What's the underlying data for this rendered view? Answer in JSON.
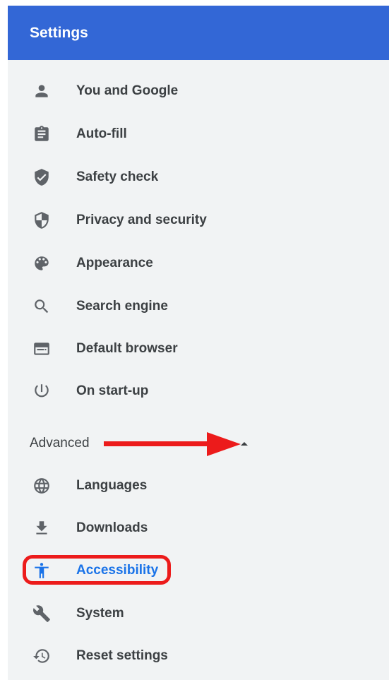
{
  "header": {
    "title": "Settings"
  },
  "menu": [
    {
      "label": "You and Google",
      "icon": "person-icon"
    },
    {
      "label": "Auto-fill",
      "icon": "clipboard-icon"
    },
    {
      "label": "Safety check",
      "icon": "shield-check-icon"
    },
    {
      "label": "Privacy and security",
      "icon": "shield-half-icon"
    },
    {
      "label": "Appearance",
      "icon": "palette-icon"
    },
    {
      "label": "Search engine",
      "icon": "search-icon"
    },
    {
      "label": "Default browser",
      "icon": "browser-window-icon"
    },
    {
      "label": "On start-up",
      "icon": "power-icon"
    }
  ],
  "advanced": {
    "label": "Advanced",
    "expanded": true,
    "items": [
      {
        "label": "Languages",
        "icon": "globe-icon"
      },
      {
        "label": "Downloads",
        "icon": "download-icon"
      },
      {
        "label": "Accessibility",
        "icon": "accessibility-icon",
        "selected": true
      },
      {
        "label": "System",
        "icon": "wrench-icon"
      },
      {
        "label": "Reset settings",
        "icon": "history-icon"
      }
    ]
  },
  "colors": {
    "header": "#3367d6",
    "background": "#f1f3f4",
    "text": "#3c4043",
    "icon": "#5f6368",
    "active": "#1a73e8",
    "annotation": "#ec1b1b"
  }
}
